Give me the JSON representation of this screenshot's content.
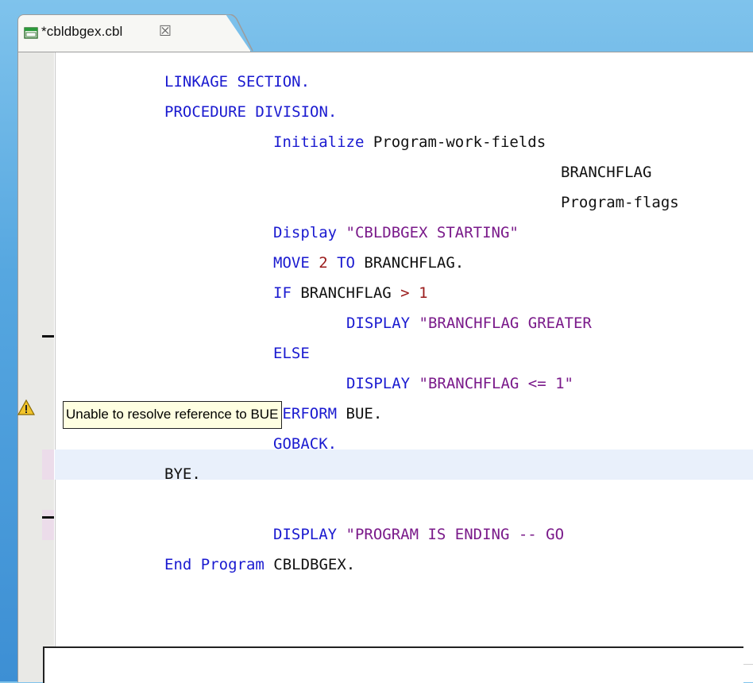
{
  "tab": {
    "title": "*cbldbgex.cbl",
    "close_glyph": "☒",
    "icon": "cobol-file-icon"
  },
  "editor": {
    "lines": [
      [
        {
          "t": "LINKAGE SECTION.",
          "c": "kw"
        }
      ],
      [
        {
          "t": "PROCEDURE DIVISION.",
          "c": "kw"
        }
      ],
      [
        {
          "t": "Initialize ",
          "c": "kw"
        },
        {
          "t": "Program-work-fields",
          "c": "id"
        }
      ],
      [
        {
          "t": "BRANCHFLAG",
          "c": "id"
        }
      ],
      [
        {
          "t": "Program-flags",
          "c": "id"
        }
      ],
      [
        {
          "t": "Display ",
          "c": "kw"
        },
        {
          "t": "\"CBLDBGEX STARTING\"",
          "c": "str"
        }
      ],
      [
        {
          "t": "MOVE ",
          "c": "kw"
        },
        {
          "t": "2",
          "c": "num"
        },
        {
          "t": " TO ",
          "c": "kw"
        },
        {
          "t": "BRANCHFLAG.",
          "c": "id"
        }
      ],
      [
        {
          "t": "IF ",
          "c": "kw"
        },
        {
          "t": "BRANCHFLAG ",
          "c": "id"
        },
        {
          "t": ">",
          "c": "op"
        },
        {
          "t": " 1",
          "c": "num"
        }
      ],
      [
        {
          "t": "DISPLAY ",
          "c": "kw"
        },
        {
          "t": "\"BRANCHFLAG GREATER",
          "c": "str"
        }
      ],
      [
        {
          "t": "ELSE",
          "c": "kw"
        }
      ],
      [
        {
          "t": "DISPLAY ",
          "c": "kw"
        },
        {
          "t": "\"BRANCHFLAG <= 1\"",
          "c": "str"
        }
      ],
      [
        {
          "t": "PERFORM ",
          "c": "kw"
        },
        {
          "t": "BUE.",
          "c": "id"
        }
      ],
      [
        {
          "t": "GOBACK.",
          "c": "kw"
        }
      ],
      [
        {
          "t": "BYE.",
          "c": "id"
        }
      ],
      [],
      [
        {
          "t": "DISPLAY ",
          "c": "kw"
        },
        {
          "t": "\"PROGRAM IS ENDING -- GO",
          "c": "str"
        }
      ],
      [
        {
          "t": "End Program ",
          "c": "kw"
        },
        {
          "t": "CBLDBGEX.",
          "c": "id"
        }
      ]
    ]
  },
  "tooltip": {
    "text": "Unable to resolve reference to BUE"
  },
  "warning_icon": "warning-icon"
}
